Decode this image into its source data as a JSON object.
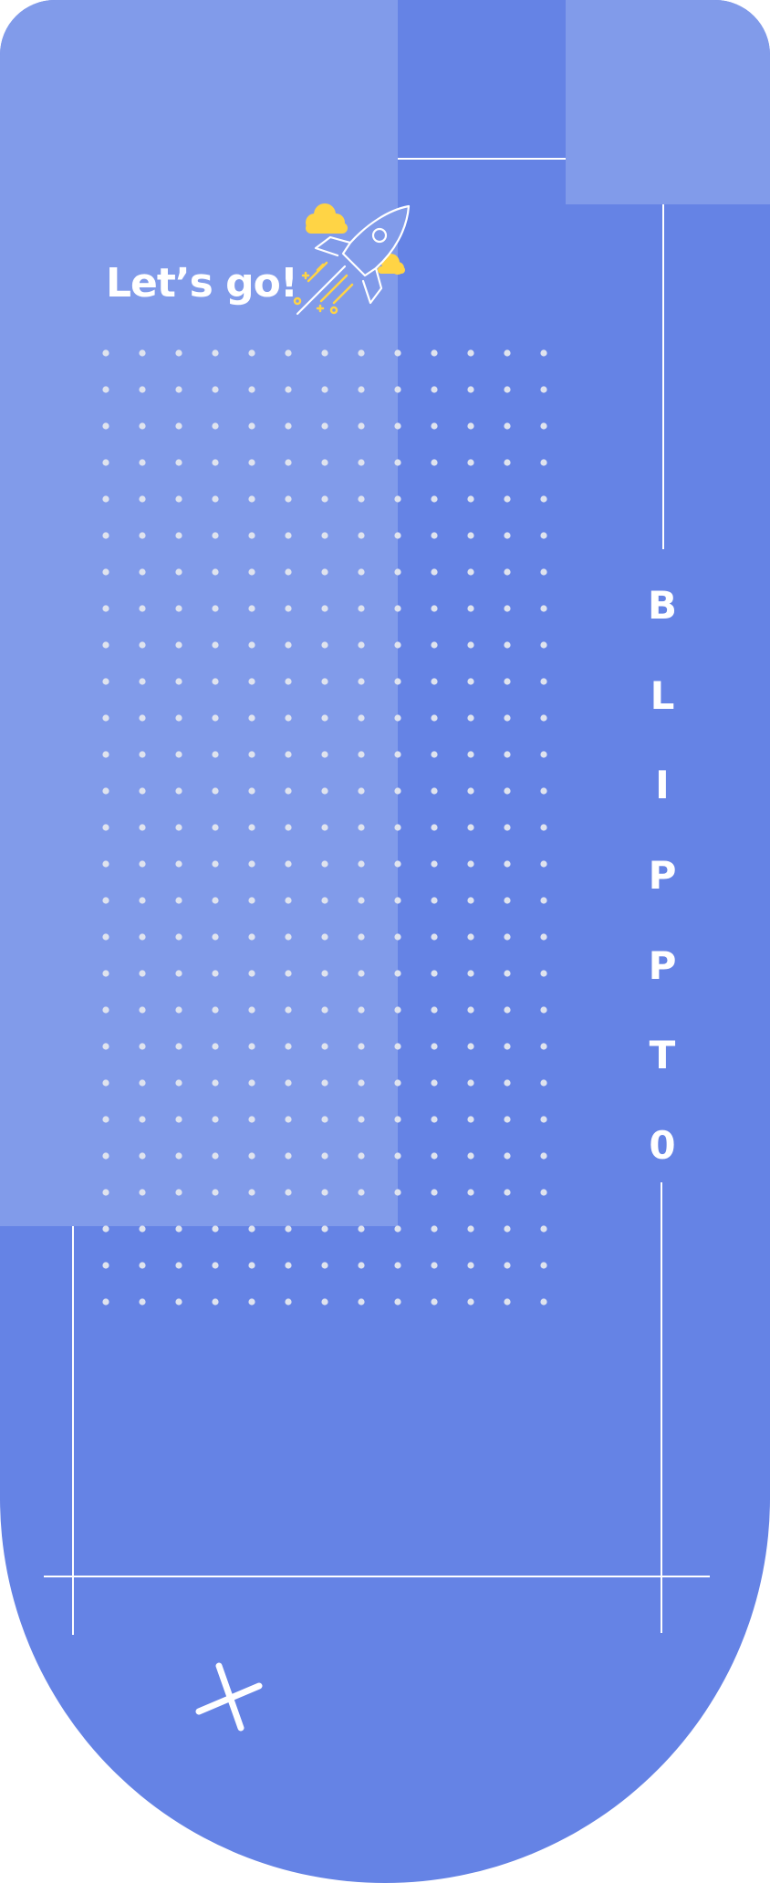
{
  "tagline": "Let’s go!",
  "brand_letters": [
    "B",
    "L",
    "I",
    "P",
    "P",
    "T",
    "0"
  ],
  "icons": {
    "rocket": "rocket-icon",
    "clouds": "cloud-icon",
    "close": "close-icon"
  },
  "colors": {
    "background": "#6583e5",
    "panel": "#819bea",
    "dots": "#dfe3ee",
    "accent": "#ffd445",
    "line": "#ffffff"
  }
}
